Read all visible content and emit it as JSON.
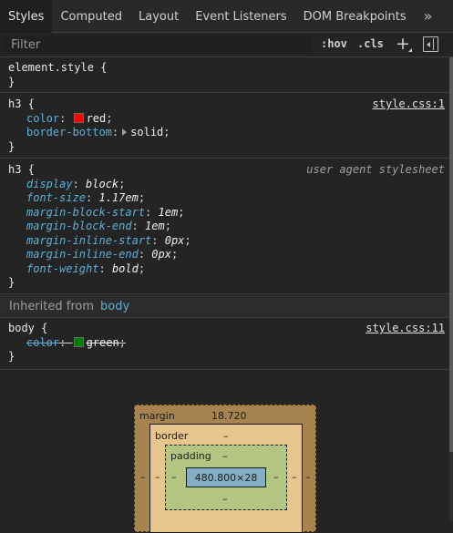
{
  "tabs": [
    "Styles",
    "Computed",
    "Layout",
    "Event Listeners",
    "DOM Breakpoints"
  ],
  "tabs_more_glyph": "»",
  "filter": {
    "placeholder": "Filter",
    "hov": ":hov",
    "cls": ".cls",
    "add_glyph": "+"
  },
  "rules": {
    "element_style": {
      "selector": "element.style {",
      "close": "}"
    },
    "h3_author": {
      "selector": "h3 {",
      "source": "style.css:1",
      "decls": [
        {
          "prop": "color",
          "value": "red",
          "swatch": "#ff0000"
        },
        {
          "prop": "border-bottom",
          "value": "solid"
        }
      ],
      "close": "}"
    },
    "h3_ua": {
      "selector": "h3 {",
      "source": "user agent stylesheet",
      "decls": [
        {
          "prop": "display",
          "value": "block"
        },
        {
          "prop": "font-size",
          "value": "1.17em"
        },
        {
          "prop": "margin-block-start",
          "value": "1em"
        },
        {
          "prop": "margin-block-end",
          "value": "1em"
        },
        {
          "prop": "margin-inline-start",
          "value": "0px"
        },
        {
          "prop": "margin-inline-end",
          "value": "0px"
        },
        {
          "prop": "font-weight",
          "value": "bold"
        }
      ],
      "close": "}"
    },
    "body_rule": {
      "selector": "body {",
      "source": "style.css:11",
      "decls": [
        {
          "prop": "color",
          "value": "green",
          "swatch": "#008000"
        }
      ],
      "close": "}"
    }
  },
  "inherited": {
    "label": "Inherited from",
    "link": "body"
  },
  "box_model": {
    "margin_label": "margin",
    "margin_top": "18.720",
    "margin_left": "–",
    "margin_right": "–",
    "border_label": "border",
    "border_top": "–",
    "border_left": "–",
    "border_right": "–",
    "padding_label": "padding",
    "padding_top": "–",
    "padding_bottom": "–",
    "padding_left": "–",
    "padding_right": "–",
    "content": "480.800×28"
  },
  "colors": {
    "background": "#242424",
    "property": "#5db0d7",
    "tab_active_bg": "#1f1f1f"
  }
}
